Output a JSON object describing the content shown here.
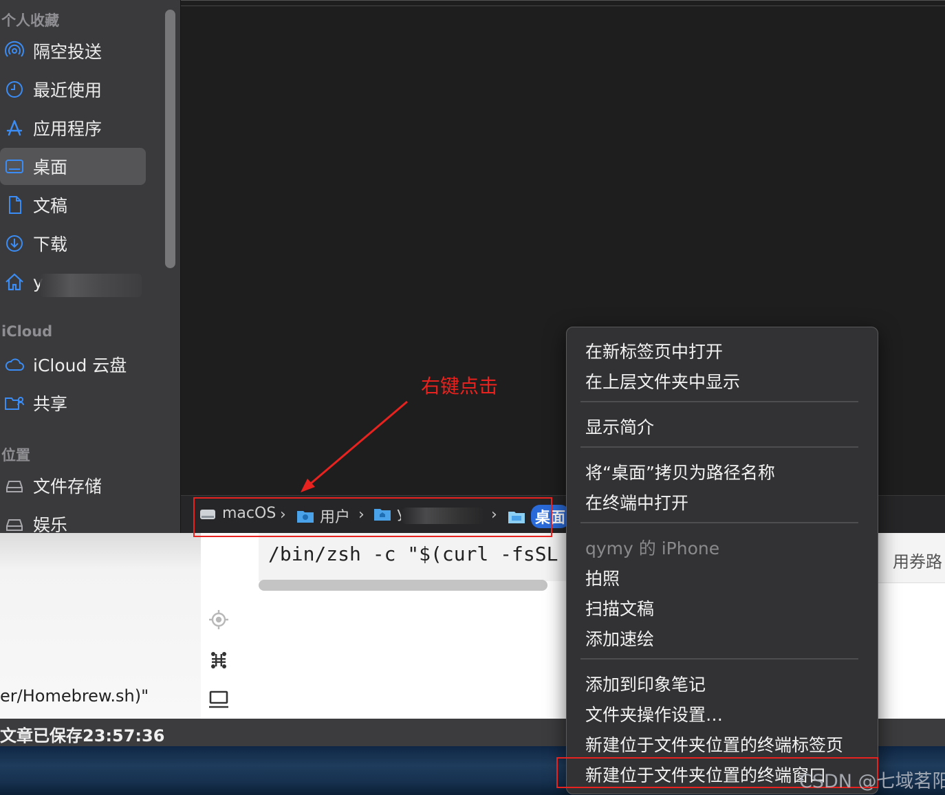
{
  "sidebar": {
    "favorites_header": "个人收藏",
    "favorites": [
      {
        "label": "隔空投送",
        "icon": "airdrop-icon"
      },
      {
        "label": "最近使用",
        "icon": "clock-icon"
      },
      {
        "label": "应用程序",
        "icon": "applications-icon"
      },
      {
        "label": "桌面",
        "icon": "desktop-icon",
        "selected": true
      },
      {
        "label": "文稿",
        "icon": "document-icon"
      },
      {
        "label": "下载",
        "icon": "download-icon"
      },
      {
        "label": "y",
        "icon": "home-icon"
      }
    ],
    "icloud_header": "iCloud",
    "icloud": [
      {
        "label": "iCloud 云盘",
        "icon": "cloud-icon"
      },
      {
        "label": "共享",
        "icon": "shared-folder-icon"
      }
    ],
    "locations_header": "位置",
    "locations": [
      {
        "label": "文件存储",
        "icon": "disk-icon"
      },
      {
        "label": "娱乐",
        "icon": "disk-icon"
      }
    ]
  },
  "pathbar": {
    "crumbs": [
      "macOS",
      "用户",
      "y",
      "桌面"
    ]
  },
  "annotation": {
    "label": "右键点击",
    "color": "#e8231f"
  },
  "context_menu": {
    "items": [
      "在新标签页中打开",
      "在上层文件夹中显示",
      "显示简介",
      "将“桌面”拷贝为路径名称",
      "在终端中打开",
      "qymy 的 iPhone",
      "拍照",
      "扫描文稿",
      "添加速绘",
      "添加到印象笔记",
      "文件夹操作设置…",
      "新建位于文件夹位置的终端标签页",
      "新建位于文件夹位置的终端窗口"
    ]
  },
  "editor": {
    "code_line": "/bin/zsh -c \"$(curl -fsSL",
    "code_fragment": "er/Homebrew.sh)\"",
    "right_text": "用券路",
    "status": "文章已保存23:57:36"
  },
  "watermark": "CSDN @七域茗阳",
  "colors": {
    "sidebar_bg": "#3a3a3c",
    "selection_bg": "#555557",
    "accent_blue": "#2a6ad8",
    "annotation_red": "#e8231f",
    "menu_bg": "#323234"
  }
}
